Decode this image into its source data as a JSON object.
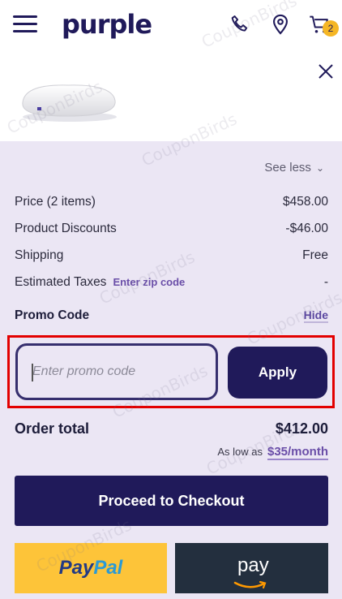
{
  "header": {
    "logo": "purple",
    "cart_count": "2"
  },
  "summary": {
    "see_less": "See less",
    "rows": [
      {
        "label": "Price (2 items)",
        "value": "$458.00"
      },
      {
        "label": "Product Discounts",
        "value": "-$46.00"
      },
      {
        "label": "Shipping",
        "value": "Free"
      },
      {
        "label": "Estimated Taxes",
        "value": "-"
      }
    ],
    "zip_link": "Enter zip code",
    "promo_title": "Promo Code",
    "hide_link": "Hide"
  },
  "promo": {
    "placeholder": "Enter promo code",
    "apply": "Apply"
  },
  "total": {
    "label": "Order total",
    "value": "$412.00",
    "as_low_as": "As low as",
    "monthly": "$35/month"
  },
  "actions": {
    "checkout": "Proceed to Checkout",
    "paypal_1": "Pay",
    "paypal_2": "Pal",
    "amazon": "pay"
  },
  "watermark": "CouponBirds",
  "colors": {
    "brand": "#201a5a",
    "panel": "#ebe6f4",
    "highlight": "#e30000",
    "badge": "#f5b625"
  }
}
